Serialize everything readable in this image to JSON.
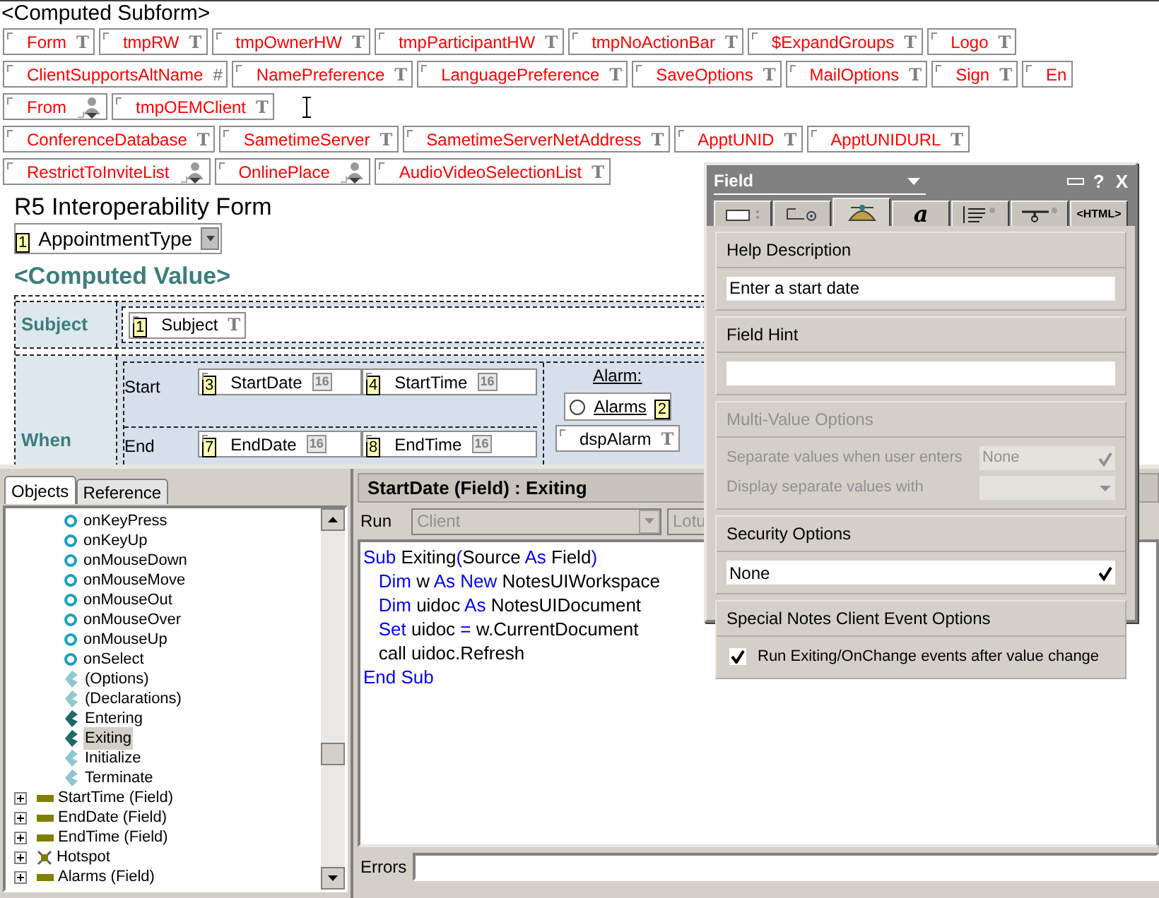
{
  "subform_title": "<Computed Subform>",
  "field_rows": [
    [
      {
        "name": "Form",
        "kind": "text",
        "mark": "T"
      },
      {
        "name": "tmpRW",
        "kind": "text",
        "mark": "T"
      },
      {
        "name": "tmpOwnerHW",
        "kind": "text",
        "mark": "T"
      },
      {
        "name": "tmpParticipantHW",
        "kind": "text",
        "mark": "T"
      },
      {
        "name": "tmpNoActionBar",
        "kind": "text",
        "mark": "T"
      },
      {
        "name": "$ExpandGroups",
        "kind": "text",
        "mark": "T"
      },
      {
        "name": "Logo",
        "kind": "text",
        "mark": "T"
      }
    ],
    [
      {
        "name": "ClientSupportsAltName",
        "kind": "number",
        "mark": "#"
      },
      {
        "name": "NamePreference",
        "kind": "text",
        "mark": "T"
      },
      {
        "name": "LanguagePreference",
        "kind": "text",
        "mark": "T"
      },
      {
        "name": "SaveOptions",
        "kind": "text",
        "mark": "T"
      },
      {
        "name": "MailOptions",
        "kind": "text",
        "mark": "T"
      },
      {
        "name": "Sign",
        "kind": "text",
        "mark": "T"
      },
      {
        "name": "En",
        "kind": "text"
      }
    ],
    [
      {
        "name": "From",
        "kind": "names"
      },
      {
        "name": "tmpOEMClient",
        "kind": "text",
        "mark": "T"
      }
    ],
    [
      {
        "name": "ConferenceDatabase",
        "kind": "text",
        "mark": "T"
      },
      {
        "name": "SametimeServer",
        "kind": "text",
        "mark": "T"
      },
      {
        "name": "SametimeServerNetAddress",
        "kind": "text",
        "mark": "T"
      },
      {
        "name": "ApptUNID",
        "kind": "text",
        "mark": "T"
      },
      {
        "name": "ApptUNIDURL",
        "kind": "text",
        "mark": "T"
      }
    ],
    [
      {
        "name": "RestrictToInviteList",
        "kind": "names"
      },
      {
        "name": "OnlinePlace",
        "kind": "names"
      },
      {
        "name": "AudioVideoSelectionList",
        "kind": "text",
        "mark": "T"
      }
    ]
  ],
  "form_title": "R5 Interoperability Form",
  "appointment_type": {
    "tab_order": "1",
    "name": "AppointmentType"
  },
  "computed_value": "<Computed Value>",
  "table": {
    "subject_label": "Subject",
    "subject_field": {
      "name": "Subject",
      "kind": "text",
      "mark": "T",
      "tab_order": "1"
    },
    "when_label": "When",
    "start_label": "Start",
    "end_label": "End",
    "start_date": {
      "name": "StartDate",
      "kind": "date",
      "mark": "16",
      "tab_order": "3"
    },
    "start_time": {
      "name": "StartTime",
      "kind": "date",
      "mark": "16",
      "tab_order": "4"
    },
    "end_date": {
      "name": "EndDate",
      "kind": "date",
      "mark": "16",
      "tab_order": "7"
    },
    "end_time": {
      "name": "EndTime",
      "kind": "date",
      "mark": "16",
      "tab_order": "8"
    },
    "alarm_label": "Alarm:",
    "alarms": {
      "label": "Alarms",
      "tab_order": "2",
      "selected": false
    },
    "dsp_alarm": {
      "name": "dspAlarm",
      "kind": "text",
      "mark": "T"
    }
  },
  "left_tabs": [
    {
      "label": "Objects",
      "selected": true
    },
    {
      "label": "Reference",
      "selected": false
    }
  ],
  "tree": [
    {
      "expanded": true,
      "children": [
        {
          "label": "onKeyPress",
          "kind": "event",
          "selected": false
        },
        {
          "label": "onKeyUp",
          "kind": "event",
          "selected": false
        },
        {
          "label": "onMouseDown",
          "kind": "event",
          "selected": false
        },
        {
          "label": "onMouseMove",
          "kind": "event",
          "selected": false
        },
        {
          "label": "onMouseOut",
          "kind": "event",
          "selected": false
        },
        {
          "label": "onMouseOver",
          "kind": "event",
          "selected": false
        },
        {
          "label": "onMouseUp",
          "kind": "event",
          "selected": false
        },
        {
          "label": "onSelect",
          "kind": "event",
          "selected": false
        },
        {
          "label": "(Options)",
          "kind": "script",
          "selected": false
        },
        {
          "label": "(Declarations)",
          "kind": "script",
          "selected": false
        },
        {
          "label": "Entering",
          "kind": "script-edited",
          "selected": false
        },
        {
          "label": "Exiting",
          "kind": "script-edited",
          "selected": true
        },
        {
          "label": "Initialize",
          "kind": "script",
          "selected": false
        },
        {
          "label": "Terminate",
          "kind": "script",
          "selected": false
        }
      ]
    },
    {
      "label": "StartTime (Field)",
      "kind": "field",
      "expanded": false
    },
    {
      "label": "EndDate (Field)",
      "kind": "field",
      "expanded": false
    },
    {
      "label": "EndTime (Field)",
      "kind": "field",
      "expanded": false
    },
    {
      "label": "Hotspot",
      "kind": "hotspot",
      "expanded": false
    },
    {
      "label": "Alarms (Field)",
      "kind": "field",
      "expanded": false
    }
  ],
  "editor": {
    "title": "StartDate (Field) : Exiting",
    "run_label": "Run",
    "run_value": "Client",
    "language_value": "Lotu",
    "code": [
      {
        "tokens": [
          {
            "text": "Sub",
            "kind": "keyword"
          },
          {
            "text": " Exiting",
            "kind": "plain"
          },
          {
            "text": "(",
            "kind": "keyword"
          },
          {
            "text": "Source ",
            "kind": "plain"
          },
          {
            "text": "As",
            "kind": "keyword"
          },
          {
            "text": " Field",
            "kind": "plain"
          },
          {
            "text": ")",
            "kind": "keyword"
          }
        ]
      },
      {
        "tokens": [
          {
            "text": "   Dim",
            "kind": "keyword"
          },
          {
            "text": " w ",
            "kind": "plain"
          },
          {
            "text": "As New",
            "kind": "keyword"
          },
          {
            "text": " NotesUIWorkspace",
            "kind": "plain"
          }
        ]
      },
      {
        "tokens": [
          {
            "text": "   Dim",
            "kind": "keyword"
          },
          {
            "text": " uidoc ",
            "kind": "plain"
          },
          {
            "text": "As",
            "kind": "keyword"
          },
          {
            "text": " NotesUIDocument",
            "kind": "plain"
          }
        ]
      },
      {
        "tokens": [
          {
            "text": "   Set",
            "kind": "keyword"
          },
          {
            "text": " uidoc ",
            "kind": "plain"
          },
          {
            "text": "=",
            "kind": "keyword"
          },
          {
            "text": " w.CurrentDocument",
            "kind": "plain"
          }
        ]
      },
      {
        "tokens": [
          {
            "text": "   call uidoc.Refresh",
            "kind": "plain"
          }
        ]
      },
      {
        "tokens": [
          {
            "text": "End Sub",
            "kind": "keyword"
          }
        ]
      }
    ],
    "errors_label": "Errors"
  },
  "properties": {
    "title": "Field",
    "help_button": "?",
    "close_button": "X",
    "tabs": [
      {
        "kind": "basics",
        "selected": false
      },
      {
        "kind": "control",
        "selected": false
      },
      {
        "kind": "advanced",
        "selected": true
      },
      {
        "kind": "font",
        "label": "a",
        "selected": false
      },
      {
        "kind": "paragraph",
        "selected": false
      },
      {
        "kind": "hide",
        "selected": false
      },
      {
        "kind": "html",
        "label": "<HTML>",
        "selected": false
      }
    ],
    "help_description": {
      "heading": "Help Description",
      "value": "Enter a start date"
    },
    "field_hint": {
      "heading": "Field Hint"
    },
    "multi_value": {
      "heading": "Multi-Value Options",
      "disabled": true,
      "separate_label": "Separate values when user enters",
      "separate_value": "None",
      "display_label": "Display separate values with"
    },
    "security": {
      "heading": "Security Options",
      "value": "None"
    },
    "special": {
      "heading": "Special Notes Client Event Options",
      "option_label": "Run Exiting/OnChange events after value change",
      "checked": true
    }
  }
}
